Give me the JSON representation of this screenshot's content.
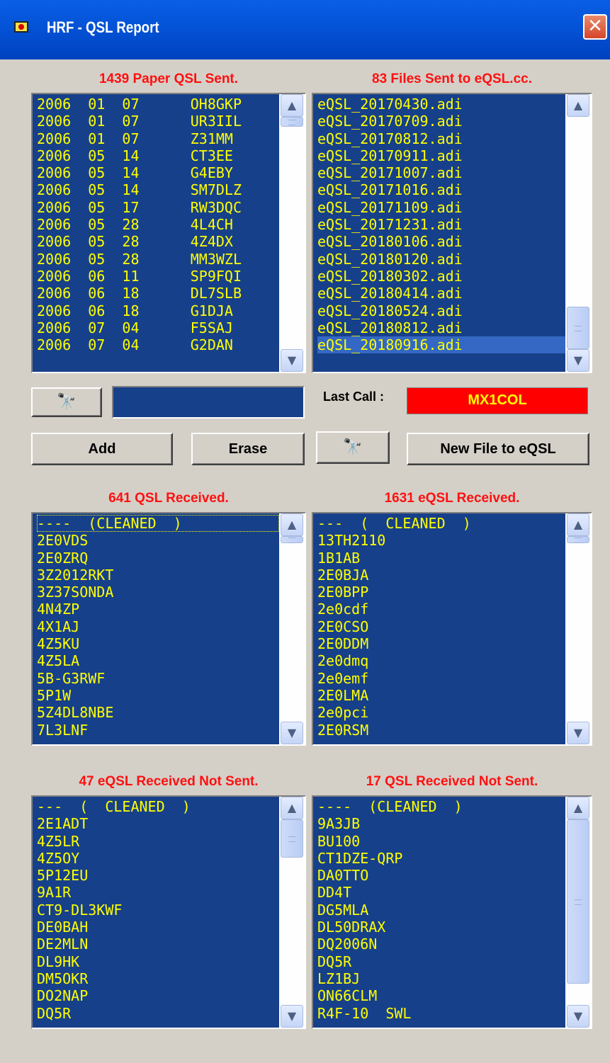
{
  "window": {
    "title": "HRF - QSL Report",
    "close_glyph": "✕"
  },
  "paper_sent": {
    "label": "1439 Paper QSL Sent.",
    "items": [
      "2006  01  07      OH8GKP",
      "2006  01  07      UR3IIL",
      "2006  01  07      Z31MM",
      "2006  05  14      CT3EE",
      "2006  05  14      G4EBY",
      "2006  05  14      SM7DLZ",
      "2006  05  17      RW3DQC",
      "2006  05  28      4L4CH",
      "2006  05  28      4Z4DX",
      "2006  05  28      MM3WZL",
      "2006  06  11      SP9FQI",
      "2006  06  18      DL7SLB",
      "2006  06  18      G1DJA",
      "2006  07  04      F5SAJ",
      "2006  07  04      G2DAN"
    ]
  },
  "eqsl_files": {
    "label": "83 Files Sent to eQSL.cc.",
    "items": [
      "eQSL_20170430.adi",
      "eQSL_20170709.adi",
      "eQSL_20170812.adi",
      "eQSL_20170911.adi",
      "eQSL_20171007.adi",
      "eQSL_20171016.adi",
      "eQSL_20171109.adi",
      "eQSL_20171231.adi",
      "eQSL_20180106.adi",
      "eQSL_20180120.adi",
      "eQSL_20180302.adi",
      "eQSL_20180414.adi",
      "eQSL_20180524.adi",
      "eQSL_20180812.adi",
      "eQSL_20180916.adi"
    ],
    "selected_index": 14
  },
  "search": {
    "field_value": "",
    "binoculars_glyph": "🔭"
  },
  "last_call": {
    "label": "Last Call :",
    "value": "MX1COL"
  },
  "buttons": {
    "add": "Add",
    "erase": "Erase",
    "new_file": "New File to eQSL"
  },
  "qsl_received": {
    "label": "641 QSL Received.",
    "items": [
      "----  (CLEANED  )",
      "2E0VDS",
      "2E0ZRQ",
      "3Z2012RKT",
      "3Z37SONDA",
      "4N4ZP",
      "4X1AJ",
      "4Z5KU",
      "4Z5LA",
      "5B-G3RWF",
      "5P1W",
      "5Z4DL8NBE",
      "7L3LNF"
    ]
  },
  "eqsl_received": {
    "label": "1631 eQSL Received.",
    "items": [
      "---  (  CLEANED  )",
      "13TH2110",
      "1B1AB",
      "2E0BJA",
      "2E0BPP",
      "2e0cdf",
      "2E0CSO",
      "2E0DDM",
      "2e0dmq",
      "2e0emf",
      "2E0LMA",
      "2e0pci",
      "2E0RSM"
    ]
  },
  "eqsl_not_sent": {
    "label": "47 eQSL Received Not Sent.",
    "items": [
      "---  (  CLEANED  )",
      "2E1ADT",
      "4Z5LR",
      "4Z5OY",
      "5P12EU",
      "9A1R",
      "CT9-DL3KWF",
      "DE0BAH",
      "DE2MLN",
      "DL9HK",
      "DM5OKR",
      "DO2NAP",
      "DQ5R"
    ]
  },
  "qsl_not_sent": {
    "label": "17 QSL Received Not Sent.",
    "items": [
      "----  (CLEANED  )",
      "9A3JB",
      "BU100",
      "CT1DZE-QRP",
      "DA0TTO",
      "DD4T",
      "DG5MLA",
      "DL50DRAX",
      "DQ2006N",
      "DQ5R",
      "LZ1BJ",
      "ON66CLM",
      "R4F-10  SWL"
    ]
  },
  "icons": {
    "scroll_up": "▲",
    "scroll_down": "▼"
  },
  "colors": {
    "list_bg": "#17408a",
    "list_text": "#ffff00",
    "label_red": "#ff1010",
    "last_call_bg": "#ff0000"
  }
}
